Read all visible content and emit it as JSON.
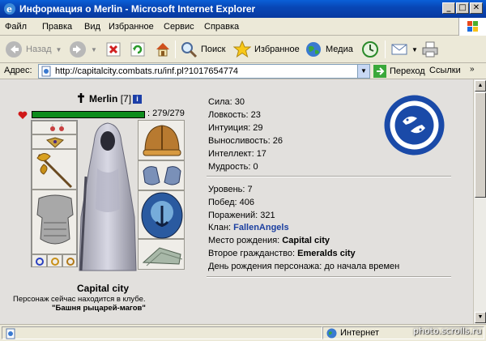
{
  "window": {
    "title": "Информация о Merlin - Microsoft Internet Explorer"
  },
  "menu": {
    "items": [
      "Файл",
      "Правка",
      "Вид",
      "Избранное",
      "Сервис",
      "Справка"
    ]
  },
  "toolbar": {
    "back": "Назад",
    "search": "Поиск",
    "favorites": "Избранное",
    "media": "Медиа"
  },
  "address": {
    "label": "Адрес:",
    "url": "http://capitalcity.combats.ru/inf.pl?1017654774",
    "go": "Переход",
    "links": "Ссылки"
  },
  "character": {
    "name": "Merlin",
    "level": "[7]",
    "hp_text": ": 279/279",
    "hp_fraction": 1.0,
    "city": "Capital city",
    "location": "Персонаж сейчас находится в клубе.",
    "club": "\"Башня рыцарей-магов\""
  },
  "stats": {
    "strength": "Сила: 30",
    "agility": "Ловкость: 23",
    "intuition": "Интуиция: 29",
    "endurance": "Выносливость: 26",
    "intellect": "Интеллект: 17",
    "wisdom": "Мудрость: 0"
  },
  "info": {
    "level": "Уровень: 7",
    "wins": "Побед: 406",
    "losses": "Поражений: 321",
    "clan_label": "Клан: ",
    "clan_name": "FallenAngels",
    "birthplace_label": "Место рождения: ",
    "birthplace": "Capital city",
    "second_citizenship_label": "Второе гражданство: ",
    "second_citizenship": "Emeralds city",
    "birthday": "День рождения персонажа: до начала времен"
  },
  "status": {
    "zone": "Интернет"
  },
  "watermark": "photo.scrolls.ru"
}
